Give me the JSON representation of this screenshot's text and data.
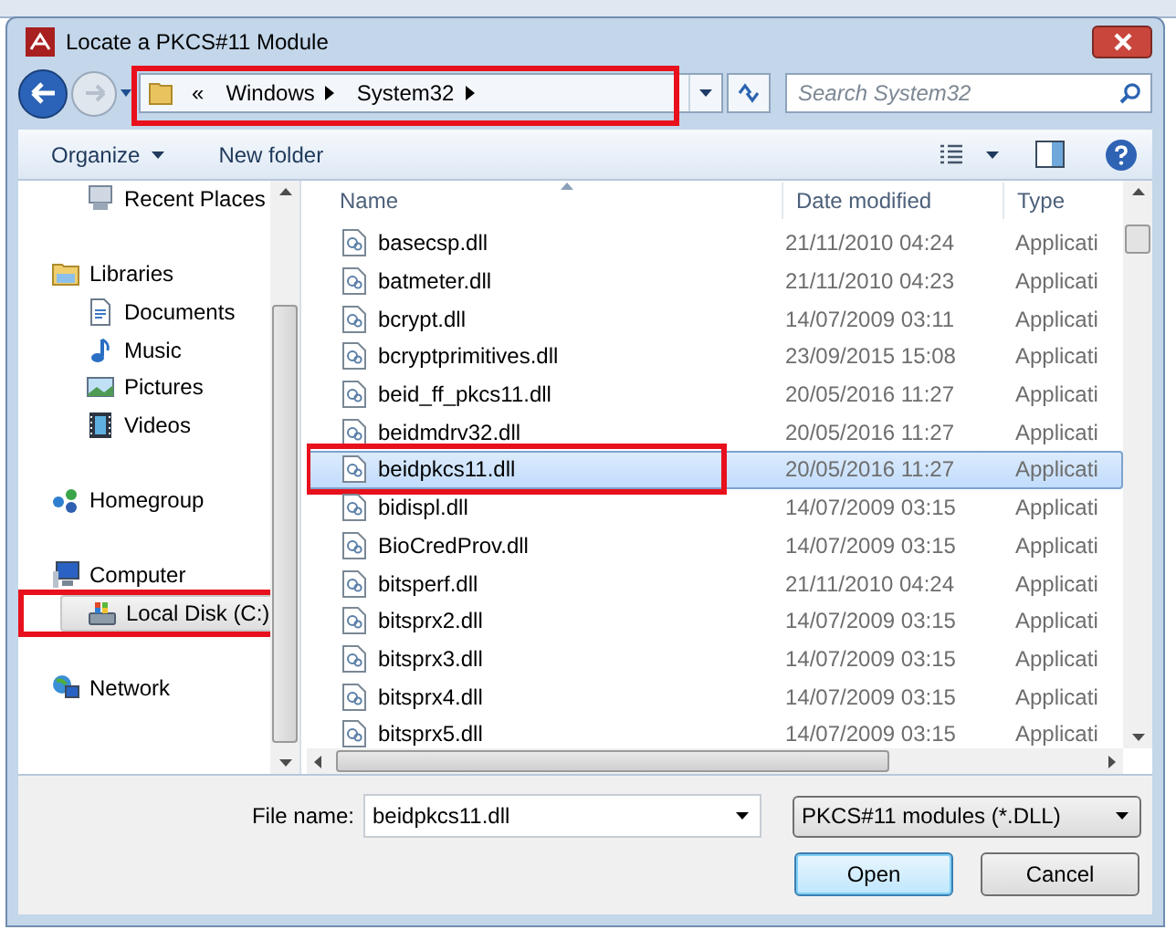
{
  "window": {
    "title": "Locate a PKCS#11 Module"
  },
  "address_bar": {
    "overflow": "«",
    "crumbs": [
      "Windows",
      "System32"
    ],
    "highlighted": true
  },
  "search": {
    "placeholder": "Search System32"
  },
  "toolbar": {
    "organize": "Organize",
    "new_folder": "New folder"
  },
  "nav": [
    {
      "children": [
        {
          "label": "Recent Places",
          "kind": "recent",
          "selected": false,
          "highlighted": false
        }
      ]
    },
    {
      "label": "Libraries",
      "kind": "library",
      "selected": false,
      "highlighted": false,
      "children": [
        {
          "label": "Documents",
          "kind": "document",
          "selected": false,
          "highlighted": false
        },
        {
          "label": "Music",
          "kind": "music",
          "selected": false,
          "highlighted": false
        },
        {
          "label": "Pictures",
          "kind": "pictures",
          "selected": false,
          "highlighted": false
        },
        {
          "label": "Videos",
          "kind": "videos",
          "selected": false,
          "highlighted": false
        }
      ]
    },
    {
      "label": "Homegroup",
      "kind": "homegroup",
      "selected": false,
      "highlighted": false
    },
    {
      "label": "Computer",
      "kind": "computer",
      "selected": false,
      "highlighted": false,
      "children": [
        {
          "label": "Local Disk (C:)",
          "kind": "disk",
          "selected": true,
          "highlighted": true
        }
      ]
    },
    {
      "label": "Network",
      "kind": "network",
      "selected": false,
      "highlighted": false
    }
  ],
  "table": {
    "columns": [
      "Name",
      "Date modified",
      "Type"
    ],
    "rows": [
      {
        "name": "basecsp.dll",
        "date": "21/11/2010 04:24",
        "type": "Applicati",
        "selected": false,
        "highlighted": false
      },
      {
        "name": "batmeter.dll",
        "date": "21/11/2010 04:23",
        "type": "Applicati",
        "selected": false,
        "highlighted": false
      },
      {
        "name": "bcrypt.dll",
        "date": "14/07/2009 03:11",
        "type": "Applicati",
        "selected": false,
        "highlighted": false
      },
      {
        "name": "bcryptprimitives.dll",
        "date": "23/09/2015 15:08",
        "type": "Applicati",
        "selected": false,
        "highlighted": false
      },
      {
        "name": "beid_ff_pkcs11.dll",
        "date": "20/05/2016 11:27",
        "type": "Applicati",
        "selected": false,
        "highlighted": false
      },
      {
        "name": "beidmdrv32.dll",
        "date": "20/05/2016 11:27",
        "type": "Applicati",
        "selected": false,
        "highlighted": false
      },
      {
        "name": "beidpkcs11.dll",
        "date": "20/05/2016 11:27",
        "type": "Applicati",
        "selected": true,
        "highlighted": true
      },
      {
        "name": "bidispl.dll",
        "date": "14/07/2009 03:15",
        "type": "Applicati",
        "selected": false,
        "highlighted": false
      },
      {
        "name": "BioCredProv.dll",
        "date": "14/07/2009 03:15",
        "type": "Applicati",
        "selected": false,
        "highlighted": false
      },
      {
        "name": "bitsperf.dll",
        "date": "21/11/2010 04:24",
        "type": "Applicati",
        "selected": false,
        "highlighted": false
      },
      {
        "name": "bitsprx2.dll",
        "date": "14/07/2009 03:15",
        "type": "Applicati",
        "selected": false,
        "highlighted": false
      },
      {
        "name": "bitsprx3.dll",
        "date": "14/07/2009 03:15",
        "type": "Applicati",
        "selected": false,
        "highlighted": false
      },
      {
        "name": "bitsprx4.dll",
        "date": "14/07/2009 03:15",
        "type": "Applicati",
        "selected": false,
        "highlighted": false
      },
      {
        "name": "bitsprx5.dll",
        "date": "14/07/2009 03:15",
        "type": "Applicati",
        "selected": false,
        "highlighted": false
      }
    ]
  },
  "file_name": {
    "label": "File name:",
    "value": "beidpkcs11.dll"
  },
  "file_type": {
    "value": "PKCS#11 modules (*.DLL)"
  },
  "buttons": [
    {
      "label": "Open",
      "default": true
    },
    {
      "label": "Cancel",
      "default": false
    }
  ]
}
